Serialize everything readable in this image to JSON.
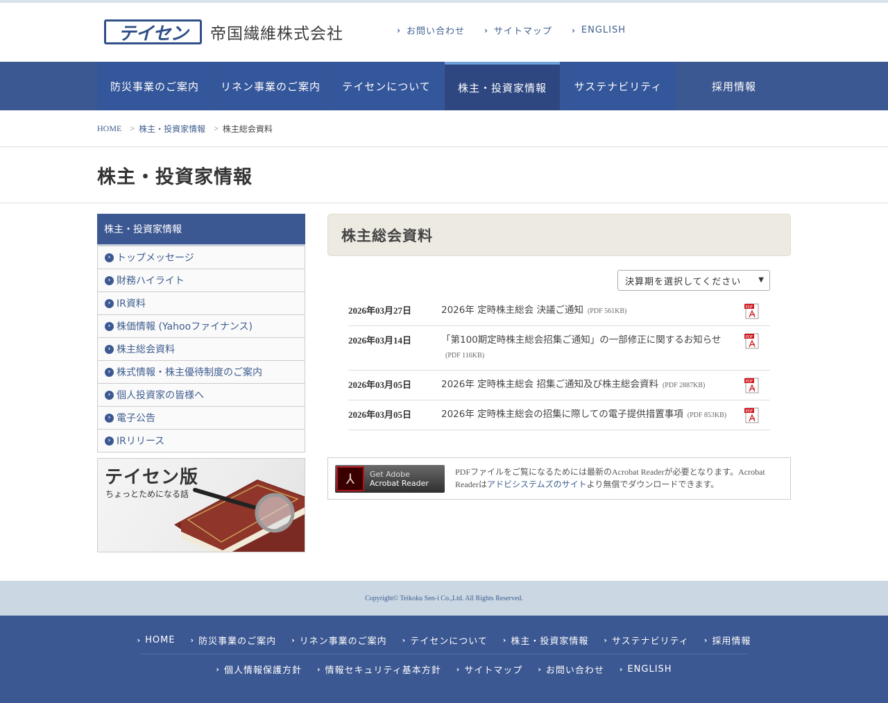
{
  "header": {
    "logo_mark": "テイセン",
    "company_name": "帝国繊維株式会社",
    "utility_links": [
      "お問い合わせ",
      "サイトマップ",
      "ENGLISH"
    ]
  },
  "global_nav": {
    "items": [
      "防災事業のご案内",
      "リネン事業のご案内",
      "テイセンについて",
      "株主・投資家情報",
      "サステナビリティ",
      "採用情報"
    ],
    "active": "株主・投資家情報"
  },
  "breadcrumb": {
    "home": "HOME",
    "parent": "株主・投資家情報",
    "current": "株主総会資料",
    "separator": ">"
  },
  "page_title": "株主・投資家情報",
  "sidebar": {
    "heading": "株主・投資家情報",
    "items": [
      "トップメッセージ",
      "財務ハイライト",
      "IR資料",
      "株価情報 (Yahooファイナンス)",
      "株主総会資料",
      "株式情報・株主優待制度のご案内",
      "個人投資家の皆様へ",
      "電子公告",
      "IRリリース"
    ],
    "banner": {
      "title": "テイセン版",
      "subtitle": "ちょっとためになる話"
    }
  },
  "main": {
    "section_title": "株主総会資料",
    "period_select": {
      "selected": "決算期を選択してください"
    },
    "documents": [
      {
        "date": "2026年03月27日",
        "title": "2026年 定時株主総会 決議ご通知",
        "size": "(PDF 561KB)"
      },
      {
        "date": "2026年03月14日",
        "title": "「第100期定時株主総会招集ご通知」の一部修正に関するお知らせ",
        "size": "(PDF 116KB)"
      },
      {
        "date": "2026年03月05日",
        "title": "2026年 定時株主総会 招集ご通知及び株主総会資料",
        "size": "(PDF 2887KB)"
      },
      {
        "date": "2026年03月05日",
        "title": "2026年 定時株主総会の招集に際しての電子提供措置事項",
        "size": "(PDF 853KB)"
      }
    ],
    "acrobat": {
      "badge_line1": "Get Adobe",
      "badge_line2": "Acrobat Reader",
      "desc_before": "PDFファイルをご覧になるためには最新のAcrobat Readerが必要となります。Acrobat Readerは",
      "desc_link": "アドビシステムズのサイト",
      "desc_after": "より無償でダウンロードできます。"
    }
  },
  "footer": {
    "copyright": "Copyright© Teikoku Sen-i Co.,Ltd. All Rights Reserved.",
    "row1": [
      "HOME",
      "防災事業のご案内",
      "リネン事業のご案内",
      "テイセンについて",
      "株主・投資家情報",
      "サステナビリティ",
      "採用情報"
    ],
    "row2": [
      "個人情報保護方針",
      "情報セキュリティ基本方針",
      "サイトマップ",
      "お問い合わせ",
      "ENGLISH"
    ]
  },
  "colors": {
    "nav_blue": "#3c5892",
    "active_accent": "#6fa2d9",
    "link_blue": "#3e5d8f",
    "section_bg": "#edeae2",
    "copyright_bg": "#cbd8e3"
  }
}
